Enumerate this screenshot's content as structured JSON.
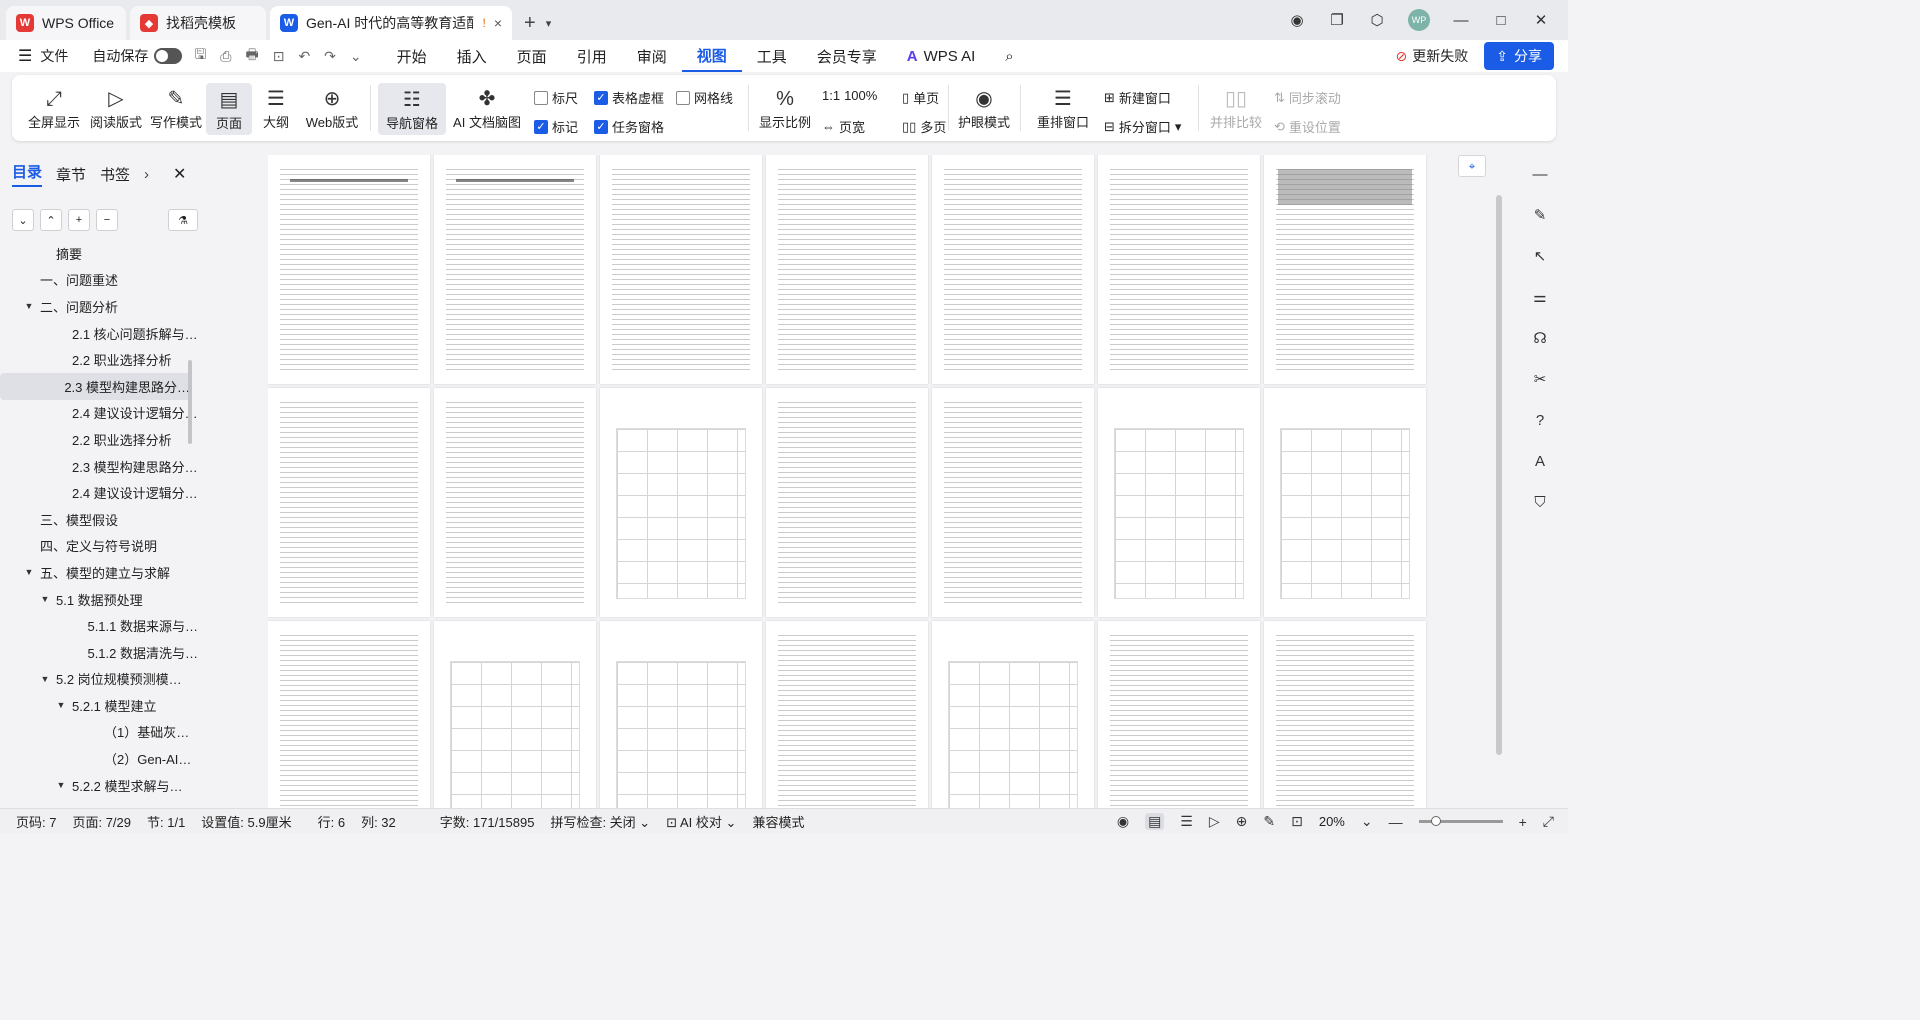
{
  "tabs": [
    {
      "label": "WPS Office",
      "icon": "wps-logo-icon"
    },
    {
      "label": "找稻壳模板",
      "icon": "daoke-icon"
    },
    {
      "label": "Gen-AI 时代的高等教育适配",
      "icon": "writer-doc-icon",
      "warning": "!",
      "close": "×"
    }
  ],
  "tabbar": {
    "new_tab": "+",
    "avatar": "WP"
  },
  "menubar": {
    "file": "文件",
    "autosave": "自动保存",
    "items": [
      "开始",
      "插入",
      "页面",
      "引用",
      "审阅",
      "视图",
      "工具",
      "会员专享",
      "WPS AI"
    ],
    "active": "视图",
    "update": "更新失败",
    "share": "分享"
  },
  "ribbon": {
    "fullscreen": "全屏显示",
    "reading": "阅读版式",
    "writing": "写作模式",
    "page": "页面",
    "outline": "大纲",
    "web": "Web版式",
    "navpane": "导航窗格",
    "ai_mindmap": "AI 文档脑图",
    "ruler": "标尺",
    "table_grid": "表格虚框",
    "gridlines": "网格线",
    "marks": "标记",
    "taskpane": "任务窗格",
    "ratio": "显示比例",
    "zoom100": "100%",
    "pagewidth": "页宽",
    "single": "单页",
    "multi": "多页",
    "eyecare": "护眼模式",
    "rearrange": "重排窗口",
    "newwindow": "新建窗口",
    "split": "拆分窗口",
    "side_by_side": "并排比较",
    "sync_scroll": "同步滚动",
    "reset_pos": "重设位置"
  },
  "ribbon_state": {
    "ruler": false,
    "table_grid": true,
    "gridlines": false,
    "marks": true,
    "taskpane": true
  },
  "nav": {
    "tabs": [
      "目录",
      "章节",
      "书签"
    ],
    "toc": [
      {
        "label": "摘要",
        "level": 1,
        "arrow": ""
      },
      {
        "label": "一、问题重述",
        "level": 0,
        "arrow": ""
      },
      {
        "label": "二、问题分析",
        "level": 0,
        "arrow": "▼"
      },
      {
        "label": "2.1 核心问题拆解与…",
        "level": 2,
        "arrow": ""
      },
      {
        "label": "2.2 职业选择分析",
        "level": 2,
        "arrow": ""
      },
      {
        "label": "2.3 模型构建思路分…",
        "level": 2,
        "arrow": "",
        "selected": true
      },
      {
        "label": "2.4 建议设计逻辑分…",
        "level": 2,
        "arrow": ""
      },
      {
        "label": "2.2 职业选择分析",
        "level": 2,
        "arrow": ""
      },
      {
        "label": "2.3 模型构建思路分…",
        "level": 2,
        "arrow": ""
      },
      {
        "label": "2.4 建议设计逻辑分…",
        "level": 2,
        "arrow": ""
      },
      {
        "label": "三、模型假设",
        "level": 0,
        "arrow": ""
      },
      {
        "label": "四、定义与符号说明",
        "level": 0,
        "arrow": ""
      },
      {
        "label": "五、模型的建立与求解",
        "level": 0,
        "arrow": "▼"
      },
      {
        "label": "5.1 数据预处理",
        "level": 1,
        "arrow": "▼"
      },
      {
        "label": "5.1.1 数据来源与…",
        "level": 3,
        "arrow": ""
      },
      {
        "label": "5.1.2 数据清洗与…",
        "level": 3,
        "arrow": ""
      },
      {
        "label": "5.2 岗位规模预测模…",
        "level": 1,
        "arrow": "▼"
      },
      {
        "label": "5.2.1 模型建立",
        "level": 2,
        "arrow": "▼"
      },
      {
        "label": "（1）基础灰…",
        "level": 4,
        "arrow": ""
      },
      {
        "label": "（2）Gen-AI…",
        "level": 4,
        "arrow": ""
      },
      {
        "label": "5.2.2 模型求解与…",
        "level": 2,
        "arrow": "▼"
      }
    ]
  },
  "status": {
    "page_num": "页码: 7",
    "page": "页面: 7/29",
    "section": "节: 1/1",
    "setting": "设置值: 5.9厘米",
    "row": "行: 6",
    "col": "列: 32",
    "words": "字数: 171/15895",
    "spell": "拼写检查: 关闭",
    "ai_check": "AI 校对",
    "compat": "兼容模式",
    "zoom": "20%"
  }
}
